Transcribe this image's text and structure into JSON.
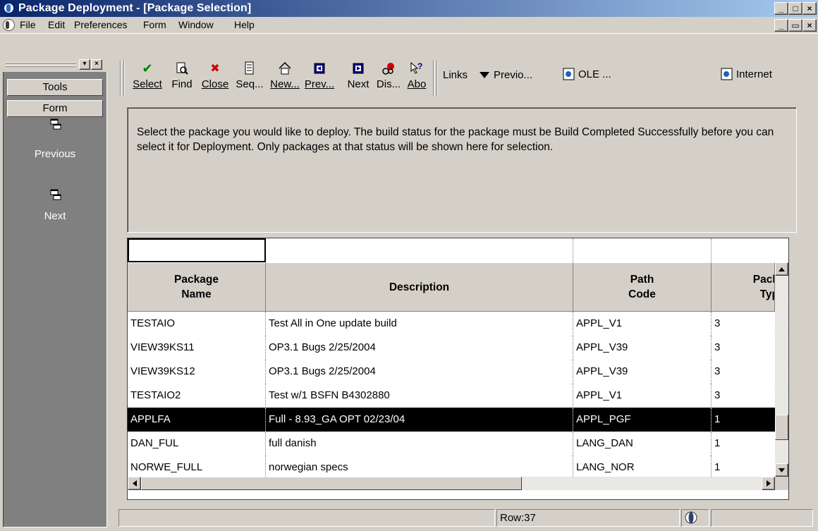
{
  "window": {
    "title": "Package Deployment - [Package Selection]",
    "controls": [
      "_",
      "□",
      "×"
    ],
    "inner_controls": [
      "_",
      "▭",
      "×"
    ]
  },
  "menu": {
    "items": [
      "File",
      "Edit",
      "Preferences",
      "Form",
      "Window",
      "Help"
    ]
  },
  "left_panel": {
    "mini_controls": [
      "▾",
      "×"
    ],
    "tabs": [
      "Tools",
      "Form"
    ],
    "nav": [
      {
        "label": "Previous",
        "icon": "window-stack-icon"
      },
      {
        "label": "Next",
        "icon": "window-stack-icon"
      }
    ]
  },
  "toolbar": {
    "buttons": [
      {
        "label": "Select",
        "icon": "checkmark-icon",
        "symbol": "✔",
        "color": "#008000"
      },
      {
        "label": "Find",
        "icon": "find-icon",
        "symbol": "🔍",
        "color": "#000000"
      },
      {
        "label": "Close",
        "icon": "close-icon",
        "symbol": "✖",
        "color": "#cc0000"
      },
      {
        "label": "Seq...",
        "icon": "sequence-icon",
        "symbol": "≣",
        "color": "#000000"
      },
      {
        "label": "New...",
        "icon": "new-icon",
        "symbol": "⌂",
        "color": "#000000"
      },
      {
        "label": "Prev...",
        "icon": "prev-record-icon",
        "symbol": "◧",
        "color": "#000080"
      },
      {
        "label": "Next",
        "icon": "next-record-icon",
        "symbol": "◨",
        "color": "#000080"
      },
      {
        "label": "Dis...",
        "icon": "display-icon",
        "symbol": "◐",
        "color": "#cc0000"
      },
      {
        "label": "Abo",
        "icon": "about-icon",
        "symbol": "?",
        "color": "#000000"
      }
    ],
    "links_label": "Links",
    "links": [
      {
        "label": "Previo...",
        "icon": "dropdown-arrow-icon"
      },
      {
        "label": "OLE ...",
        "icon": "document-icon"
      },
      {
        "label": "Internet",
        "icon": "document-icon"
      }
    ]
  },
  "instructions": "Select the package you would like to deploy.  The build status for the package must be Build Completed Successfully before you can select it for Deployment.  Only packages at that status will be shown here for selection.",
  "grid": {
    "columns": [
      {
        "line1": "Package",
        "line2": "Name"
      },
      {
        "line1": "Description",
        "line2": ""
      },
      {
        "line1": "Path",
        "line2": "Code"
      },
      {
        "line1": "Pack",
        "line2": "Typ"
      }
    ],
    "rows": [
      {
        "name": "TESTAIO",
        "description": "Test All in One update build",
        "path": "APPL_V1",
        "type": "3",
        "selected": false
      },
      {
        "name": "VIEW39KS11",
        "description": "OP3.1 Bugs 2/25/2004",
        "path": "APPL_V39",
        "type": "3",
        "selected": false
      },
      {
        "name": "VIEW39KS12",
        "description": "OP3.1 Bugs 2/25/2004",
        "path": "APPL_V39",
        "type": "3",
        "selected": false
      },
      {
        "name": "TESTAIO2",
        "description": "Test w/1 BSFN B4302880",
        "path": "APPL_V1",
        "type": "3",
        "selected": false
      },
      {
        "name": "APPLFA",
        "description": "Full - 8.93_GA OPT 02/23/04",
        "path": "APPL_PGF",
        "type": "1",
        "selected": true
      },
      {
        "name": "DAN_FUL",
        "description": "full danish",
        "path": "LANG_DAN",
        "type": "1",
        "selected": false
      },
      {
        "name": "NORWE_FULL",
        "description": "norwegian specs",
        "path": "LANG_NOR",
        "type": "1",
        "selected": false
      }
    ]
  },
  "status": {
    "row": "Row:37"
  }
}
